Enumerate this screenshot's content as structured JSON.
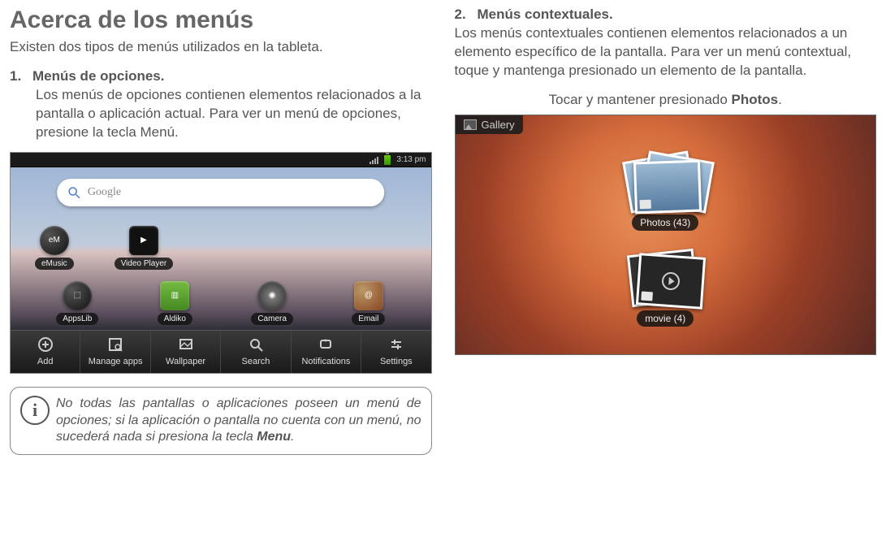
{
  "left": {
    "title": "Acerca de los menús",
    "intro": "Existen dos tipos de menús utilizados en la tableta.",
    "item1_num": "1.",
    "item1_head": "Menús de opciones.",
    "item1_body": "Los menús de opciones contienen elementos relacionados a la pantalla o aplicación actual. Para ver un menú de opciones, presione la tecla Menú.",
    "statusbar_time": "3:13 pm",
    "search_logo": "Google",
    "apps": {
      "emusic": "eMusic",
      "vplayer": "Video Player",
      "appslib": "AppsLib",
      "aldiko": "Aldiko",
      "camera": "Camera",
      "email": "Email"
    },
    "menu": {
      "add": "Add",
      "manage": "Manage apps",
      "wallpaper": "Wallpaper",
      "search": "Search",
      "notifications": "Notifications",
      "settings": "Settings"
    },
    "info_text_pre": "No todas las pantallas o aplicaciones poseen un menú de opciones; si la aplicación o pantalla no cuenta con un menú, no sucederá nada si presiona la tecla ",
    "info_text_bold": "Menu",
    "info_text_post": "."
  },
  "right": {
    "item2_num": "2.",
    "item2_head": "Menús contextuales.",
    "item2_body": "Los menús contextuales contienen elementos relacionados a un elemento específico de la pantalla. Para ver un menú contextual, toque y mantenga presionado un elemento de la pantalla.",
    "caption_pre": "Tocar y mantener presionado ",
    "caption_bold": "Photos",
    "caption_post": ".",
    "gallery_label": "Gallery",
    "album_photos": "Photos  (43)",
    "album_movie": "movie  (4)"
  }
}
